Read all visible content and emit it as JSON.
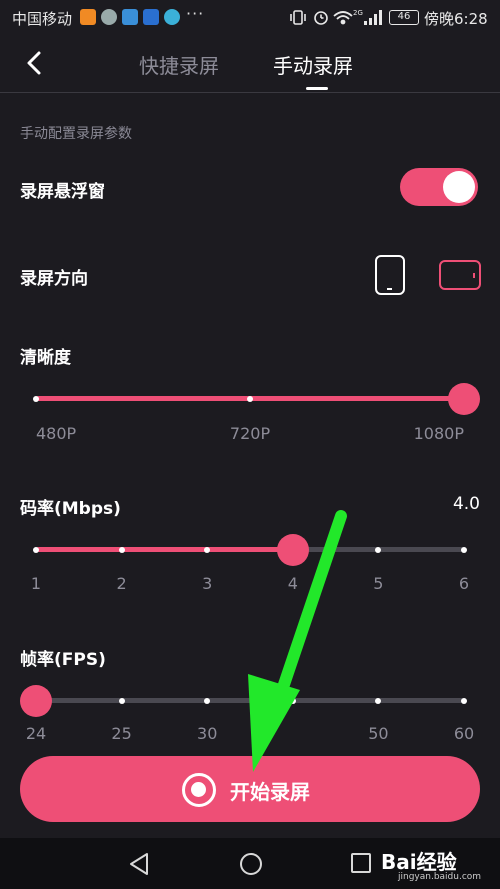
{
  "status_bar": {
    "carrier": "中国移动",
    "overflow": "···",
    "signal_tag": "2G",
    "battery": "46",
    "time": "傍晚6:28"
  },
  "header": {
    "tabs": [
      {
        "label": "快捷录屏",
        "active": false
      },
      {
        "label": "手动录屏",
        "active": true
      }
    ]
  },
  "section_caption": "手动配置录屏参数",
  "floating_window": {
    "label": "录屏悬浮窗",
    "enabled": true
  },
  "orientation": {
    "label": "录屏方向",
    "options": [
      "portrait-icon",
      "landscape-icon"
    ],
    "selected": "landscape-icon"
  },
  "resolution": {
    "label": "清晰度",
    "ticks": [
      "480P",
      "720P",
      "1080P"
    ],
    "selected_index": 2
  },
  "bitrate": {
    "label": "码率(Mbps)",
    "value": "4.0",
    "ticks": [
      "1",
      "2",
      "3",
      "4",
      "5",
      "6"
    ],
    "selected_index": 3
  },
  "framerate": {
    "label": "帧率(FPS)",
    "ticks": [
      "24",
      "25",
      "30",
      "",
      "50",
      "60"
    ],
    "selected_index": 0
  },
  "start_button": {
    "label": "开始录屏"
  },
  "watermark": {
    "main": "Bai经验",
    "sub": "jingyan.baidu.com"
  },
  "colors": {
    "accent": "#ee4f76",
    "background": "#1c1b20",
    "arrow": "#22e82a"
  }
}
